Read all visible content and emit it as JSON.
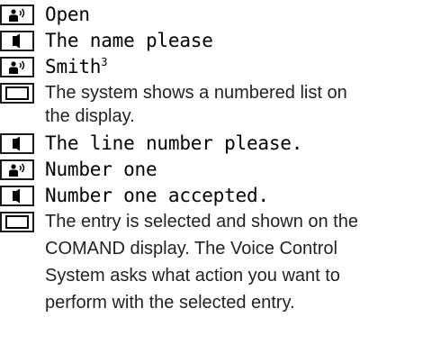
{
  "dialog": {
    "lines": [
      {
        "speaker": "user",
        "icon": "speaking-person-icon",
        "text": "Open"
      },
      {
        "speaker": "system",
        "icon": "speaker-icon",
        "text": "The name please"
      },
      {
        "speaker": "user",
        "icon": "speaking-person-icon",
        "text": "Smith",
        "footnote": "3"
      },
      {
        "speaker": "display",
        "icon": "display-icon",
        "text_lines": [
          "The system shows a numbered list on",
          "the display."
        ]
      },
      {
        "speaker": "system",
        "icon": "speaker-icon",
        "text": "The line number please."
      },
      {
        "speaker": "user",
        "icon": "speaking-person-icon",
        "text": "Number one"
      },
      {
        "speaker": "system",
        "icon": "speaker-icon",
        "text": "Number one accepted."
      },
      {
        "speaker": "display",
        "icon": "display-icon",
        "text_lines": [
          "The entry is selected and shown on the",
          "COMAND display. The Voice Control",
          "System asks what action you want to",
          "perform with the selected entry."
        ]
      }
    ]
  }
}
